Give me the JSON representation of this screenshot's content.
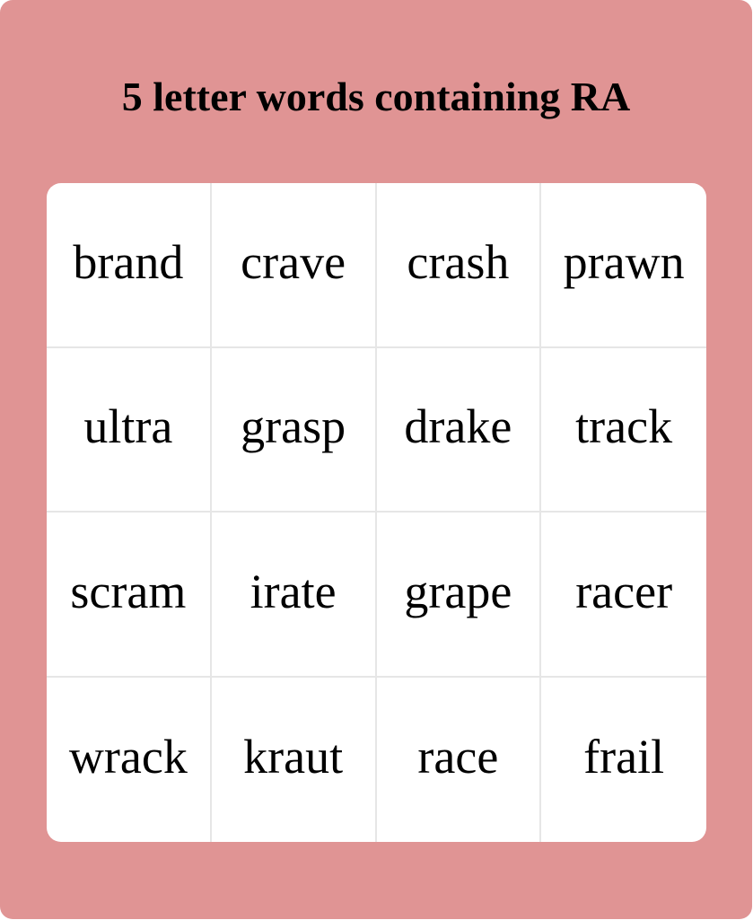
{
  "card": {
    "background_color": "#e09494",
    "title": "5 letter words containing RA"
  },
  "grid": {
    "rows": 4,
    "columns": 4,
    "cells": [
      "brand",
      "crave",
      "crash",
      "prawn",
      "ultra",
      "grasp",
      "drake",
      "track",
      "scram",
      "irate",
      "grape",
      "racer",
      "wrack",
      "kraut",
      "race",
      "frail"
    ]
  }
}
